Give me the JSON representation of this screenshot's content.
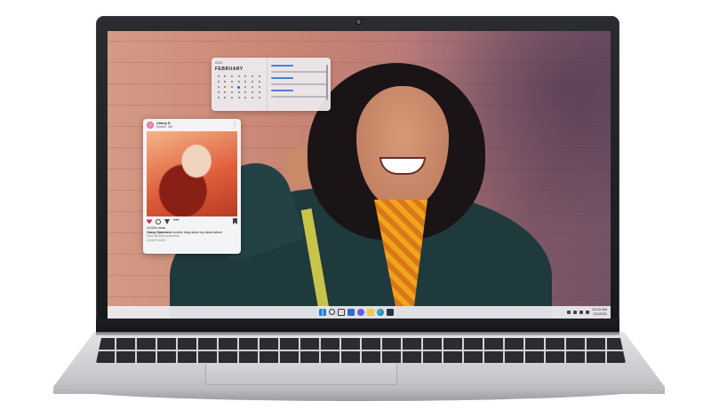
{
  "laptop": {
    "colors": {
      "bezel": "#1d1e21",
      "chassis": "#c9cacd",
      "keys": "#2b2c2f"
    }
  },
  "desktop": {
    "wallpaper_colors": {
      "wall": "#c98674",
      "jacket": "#1f3a3d",
      "scarf": "#f0a31b"
    },
    "calendar_widget": {
      "year": "2021",
      "month": "FEBRUARY",
      "accent": "#1a66d2"
    },
    "post_widget": {
      "username": "Casey S",
      "location": "Seattle, WA",
      "views": "10,528 views",
      "caption_user": "Casey Summers",
      "caption_text": "humble brag about my latest album",
      "comments_link": "View all 538 comments",
      "age": "4 DAYS AGO",
      "heart_color": "#e0245e"
    },
    "taskbar": {
      "time": "10:15 AM",
      "date": "2/1/2021",
      "icons": [
        "windows-start-icon",
        "search-icon",
        "task-view-icon",
        "widgets-icon",
        "chat-icon",
        "file-explorer-icon",
        "edge-icon",
        "store-icon"
      ]
    }
  }
}
